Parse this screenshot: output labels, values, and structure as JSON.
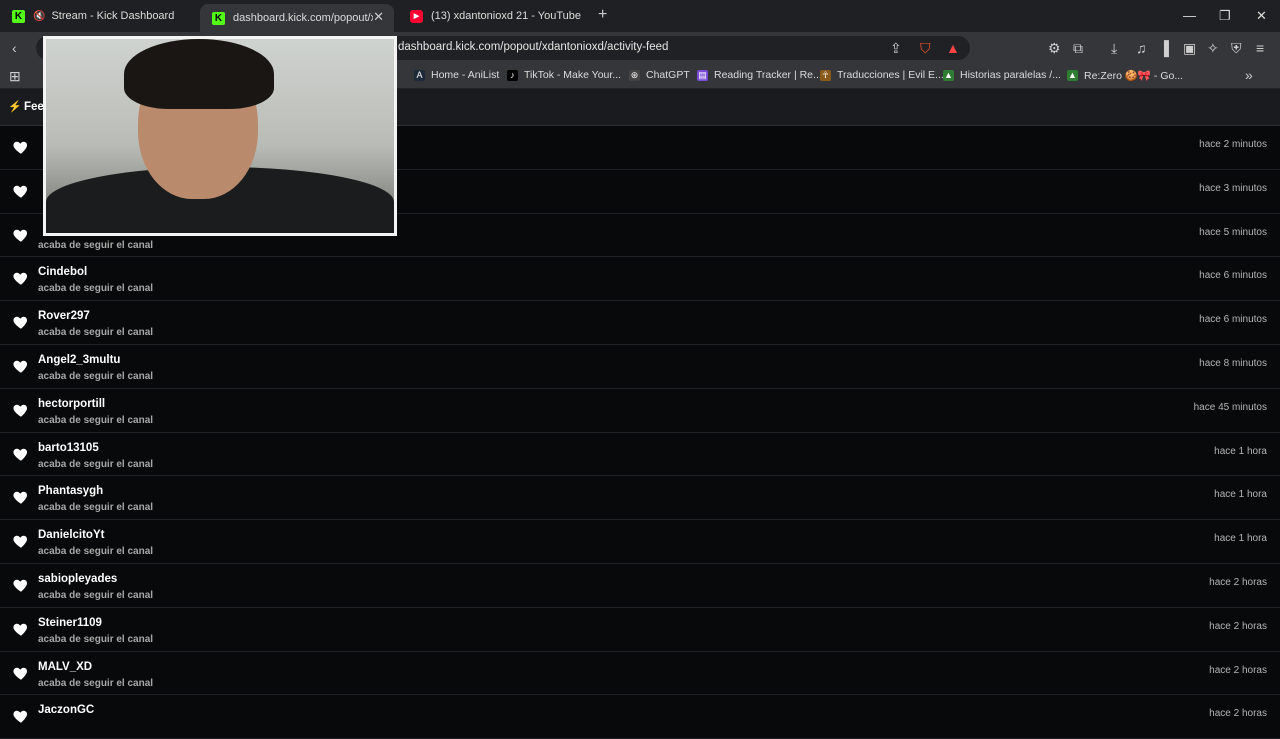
{
  "tabs": [
    {
      "title": "Stream - Kick Dashboard",
      "favicon": "K",
      "favicon_color": "#53fc18",
      "muted": true,
      "active": false
    },
    {
      "title": "dashboard.kick.com/popout/xdantonioxd/activity-feed",
      "favicon": "K",
      "favicon_color": "#53fc18",
      "active": true
    },
    {
      "title": "(13) xdantonioxd 21 - YouTube",
      "favicon": "youtube-icon",
      "favicon_color": "#ff0033",
      "active": false
    }
  ],
  "address_bar": {
    "url": "dashboard.kick.com/popout/xdantonioxd/activity-feed"
  },
  "bookmarks": [
    {
      "label": "Home - AniList",
      "icon": "A"
    },
    {
      "label": "TikTok - Make Your...",
      "icon": "♪"
    },
    {
      "label": "ChatGPT",
      "icon": "⊛"
    },
    {
      "label": "Reading Tracker | Re...",
      "icon": "▤"
    },
    {
      "label": "Traducciones | Evil E...",
      "icon": "☥"
    },
    {
      "label": "Historias paralelas /...",
      "icon": "▲"
    },
    {
      "label": "Re:Zero 🍪🎀 - Go...",
      "icon": "▲"
    }
  ],
  "feed_header": {
    "label": "Feed"
  },
  "feed": [
    {
      "user": "",
      "action": "",
      "time": "hace 2 minutos"
    },
    {
      "user": "",
      "action": "",
      "time": "hace 3 minutos"
    },
    {
      "user": "",
      "action": "acaba de seguir el canal",
      "time": "hace 5 minutos"
    },
    {
      "user": "Cindebol",
      "action": "acaba de seguir el canal",
      "time": "hace 6 minutos"
    },
    {
      "user": "Rover297",
      "action": "acaba de seguir el canal",
      "time": "hace 6 minutos"
    },
    {
      "user": "Angel2_3multu",
      "action": "acaba de seguir el canal",
      "time": "hace 8 minutos"
    },
    {
      "user": "hectorportill",
      "action": "acaba de seguir el canal",
      "time": "hace 45 minutos"
    },
    {
      "user": "barto13105",
      "action": "acaba de seguir el canal",
      "time": "hace 1 hora"
    },
    {
      "user": "Phantasygh",
      "action": "acaba de seguir el canal",
      "time": "hace 1 hora"
    },
    {
      "user": "DanielcitoYt",
      "action": "acaba de seguir el canal",
      "time": "hace 1 hora"
    },
    {
      "user": "sabiopleyades",
      "action": "acaba de seguir el canal",
      "time": "hace 2 horas"
    },
    {
      "user": "Steiner1109",
      "action": "acaba de seguir el canal",
      "time": "hace 2 horas"
    },
    {
      "user": "MALV_XD",
      "action": "acaba de seguir el canal",
      "time": "hace 2 horas"
    },
    {
      "user": "JaczonGC",
      "action": "",
      "time": "hace 2 horas"
    }
  ]
}
